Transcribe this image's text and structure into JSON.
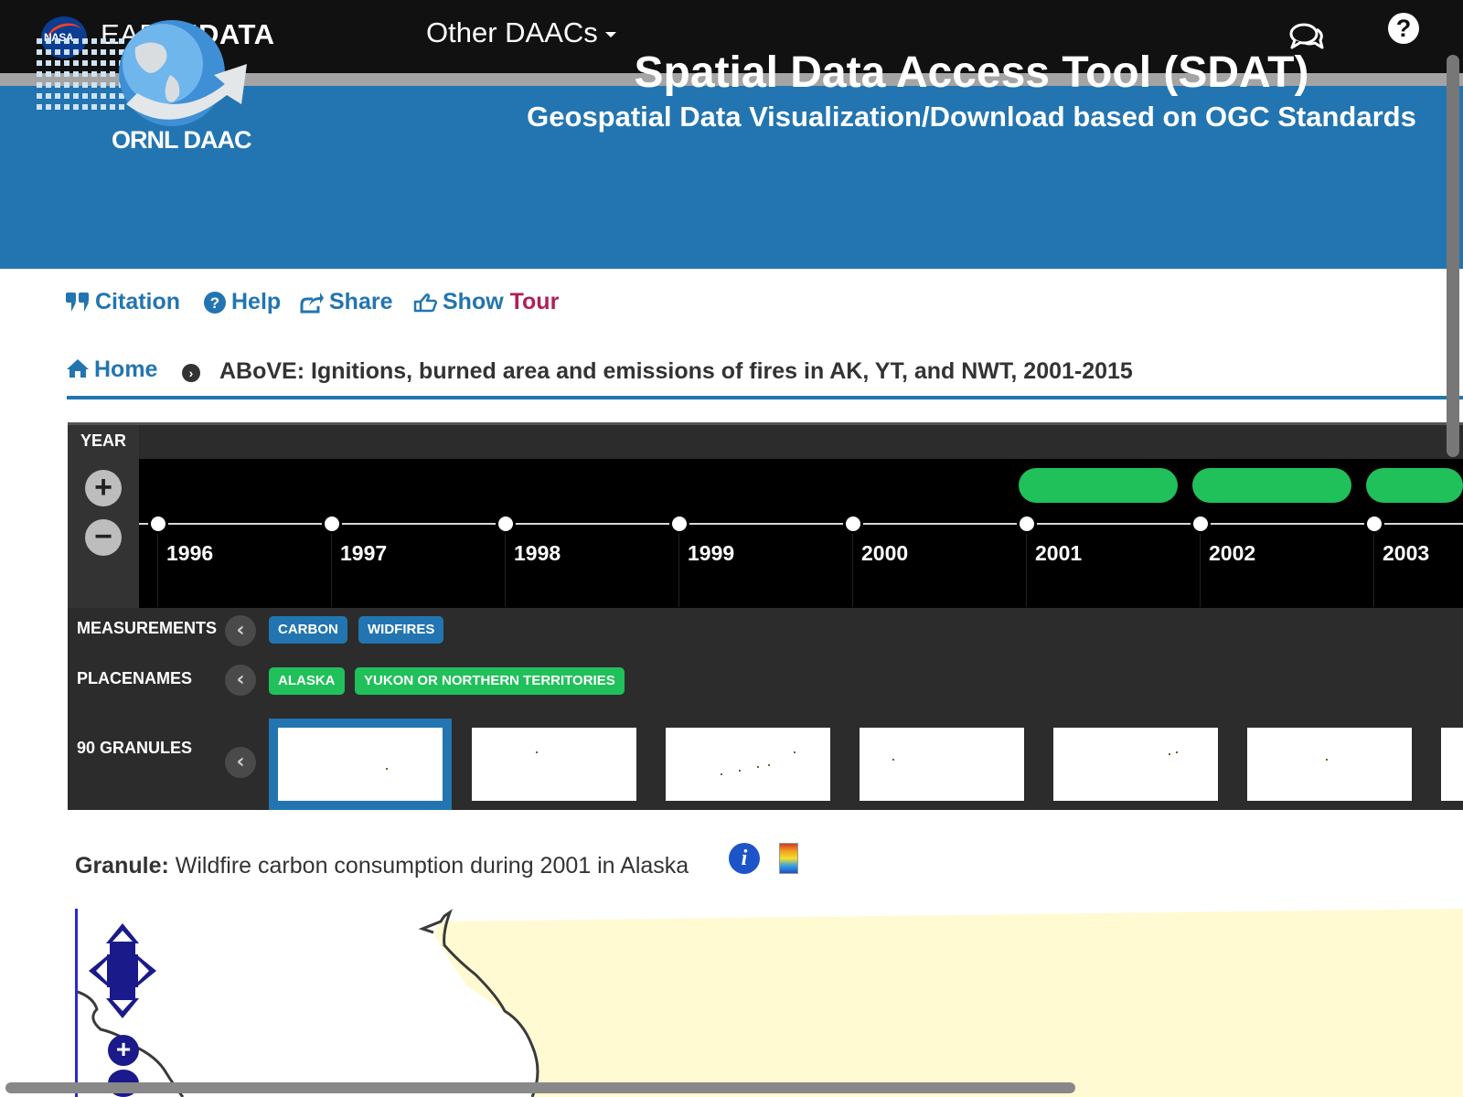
{
  "topnav": {
    "nasa_logo_text": "NASA",
    "brand_prefix": "EARTH",
    "brand_bold": "DATA",
    "daacs_menu": "Other DAACs",
    "help_symbol": "?"
  },
  "banner": {
    "logo_text": "ORNL DAAC",
    "title": "Spatial Data Access Tool (SDAT)",
    "subtitle": "Geospatial Data Visualization/Download based on OGC Standards"
  },
  "actions": {
    "citation": "Citation",
    "help": "Help",
    "share": "Share",
    "show": "Show",
    "tour": "Tour"
  },
  "breadcrumb": {
    "home": "Home",
    "dataset_title": "ABoVE: Ignitions, burned area and emissions of fires in AK, YT, and NWT, 2001-2015"
  },
  "timeline": {
    "zoom_label": "YEAR",
    "zoom_in": "+",
    "zoom_out": "−",
    "years": [
      "1996",
      "1997",
      "1998",
      "1999",
      "2000",
      "2001",
      "2002",
      "2003"
    ],
    "years_with_data": [
      "2001",
      "2002",
      "2003"
    ]
  },
  "facets": {
    "measurements_label": "MEASUREMENTS",
    "measurements": [
      "CARBON",
      "WIDFIRES"
    ],
    "placenames_label": "PLACENAMES",
    "placenames": [
      "ALASKA",
      "YUKON OR NORTHERN TERRITORIES"
    ],
    "granules_label": "90 GRANULES",
    "granule_thumbnails": 7,
    "selected_thumbnail": 1
  },
  "granule": {
    "label": "Granule:",
    "description": "Wildfire carbon consumption during 2001 in Alaska",
    "info_icon": "info-icon",
    "legend_icon": "color-legend-icon"
  },
  "map": {
    "land_color": "#fffad2",
    "control_color": "#1a1a8a"
  },
  "colors": {
    "nav_bg": "#111111",
    "banner_bg": "#2275b0",
    "accent_blue": "#2275b0",
    "accent_green": "#20c05a",
    "tour_red": "#b01e5a"
  }
}
